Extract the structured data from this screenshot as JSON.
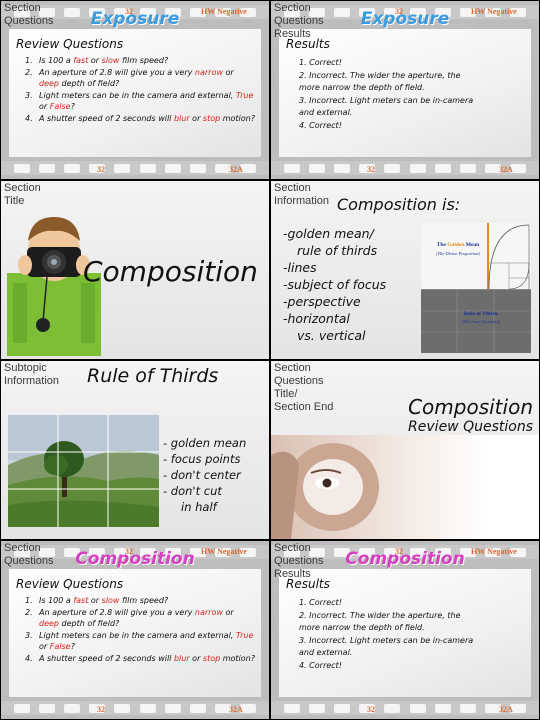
{
  "slides": {
    "s1": {
      "label": "Section\nQuestions",
      "title": "Exposure",
      "film_tag": "HW Negative",
      "num_top": "32",
      "num_bot": "32",
      "num_bot_right": "32A",
      "heading": "Review Questions",
      "items": [
        {
          "n": "1.",
          "pre": "Is 100 a ",
          "a": "fast",
          "mid": " or ",
          "b": "slow",
          "post": " film speed?"
        },
        {
          "n": "2.",
          "pre": "An aperture of 2.8 will give you a very ",
          "a": "narrow",
          "mid": " or ",
          "b": "deep",
          "post": " depth of field?"
        },
        {
          "n": "3.",
          "pre": "Light meters can be in the camera and external, ",
          "a": "True",
          "mid": " or ",
          "b": "False",
          "post": "?"
        },
        {
          "n": "4.",
          "pre": "A shutter speed of 2 seconds will ",
          "a": "blur",
          "mid": " or ",
          "b": "stop",
          "post": " motion?"
        }
      ]
    },
    "s2": {
      "label": "Section\nQuestions\nResults",
      "title": "Exposure",
      "film_tag": "HW Negative",
      "num_top": "32",
      "num_bot": "32",
      "num_bot_right": "32A",
      "heading": "Results",
      "items": [
        "1. Correct!",
        "2. Incorrect. The wider the aperture, the more narrow the depth of field.",
        "3. Incorrect. Light meters can be in-camera and external.",
        "4. Correct!"
      ]
    },
    "s3": {
      "label": "Section\nTitle",
      "title": "Composition"
    },
    "s4": {
      "label": "Section\nInformation",
      "title": "Composition is:",
      "items": [
        "-golden mean/",
        "rule of thirds",
        "-lines",
        "-subject of focus",
        "-perspective",
        "-horizontal",
        "vs. vertical"
      ],
      "golden_title_pre": "The ",
      "golden_title_em": "Golden",
      "golden_title_post": " Mean",
      "golden_sub": "(The Divine Proportion)",
      "thirds_title": "Rule of Thirds",
      "thirds_sub": "(The Lazy Geometry)"
    },
    "s5": {
      "label": "Subtopic\nInformation",
      "title": "Rule of Thirds",
      "items": [
        "- golden mean",
        "- focus points",
        "- don't center",
        "- don't cut",
        "in half"
      ]
    },
    "s6": {
      "label": "Section\nQuestions\nTitle/\nSection End",
      "title": "Composition",
      "subtitle": "Review Questions"
    },
    "s7": {
      "label": "Section\nQuestions",
      "title": "Composition",
      "film_tag": "HW Negative",
      "num_top": "32",
      "num_bot": "32",
      "num_bot_right": "32A",
      "heading": "Review Questions",
      "items": [
        {
          "n": "1.",
          "pre": "Is 100 a ",
          "a": "fast",
          "mid": " or ",
          "b": "slow",
          "post": " film speed?"
        },
        {
          "n": "2.",
          "pre": "An aperture of 2.8 will give you a very ",
          "a": "narrow",
          "mid": " or ",
          "b": "deep",
          "post": " depth of field?"
        },
        {
          "n": "3.",
          "pre": "Light meters can be in the camera and external, ",
          "a": "True",
          "mid": " or ",
          "b": "False",
          "post": "?"
        },
        {
          "n": "4.",
          "pre": "A shutter speed of 2 seconds will ",
          "a": "blur",
          "mid": " or ",
          "b": "stop",
          "post": " motion?"
        }
      ]
    },
    "s8": {
      "label": "Section\nQuestions\nResults",
      "title": "Composition",
      "film_tag": "HW Negative",
      "num_top": "32",
      "num_bot": "32",
      "num_bot_right": "32A",
      "heading": "Results",
      "items": [
        "1. Correct!",
        "2. Incorrect. The wider the aperture, the more narrow the depth of field.",
        "3. Incorrect. Light meters can be in-camera and external.",
        "4. Correct!"
      ]
    }
  },
  "colors": {
    "exposure_title": "#3b9be0",
    "composition_title": "#d63fbf",
    "answer_red": "#d8251f",
    "film_orange": "#d86a32"
  }
}
